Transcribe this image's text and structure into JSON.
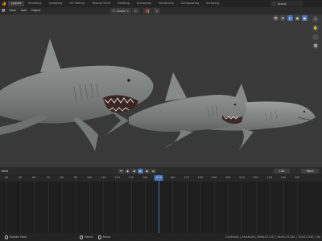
{
  "topbar": {
    "tabs": [
      "Layout",
      "Modeling",
      "Sculpting",
      "UV Editing",
      "Texture Paint",
      "Shading",
      "Animation",
      "Rendering",
      "Compositing",
      "Scripting"
    ],
    "active_tab": "Layout",
    "scene_label": "Scene"
  },
  "viewport_header": {
    "menus": [
      "View",
      "Add",
      "Object"
    ],
    "transform_orientation": "Global"
  },
  "timeline": {
    "label": "iales",
    "ticks": [
      "40",
      "50",
      "60",
      "70",
      "80",
      "90",
      "100",
      "110",
      "120",
      "130",
      "140",
      "150",
      "160",
      "170",
      "180",
      "190",
      "200",
      "210",
      "220",
      "230",
      "240",
      "250"
    ],
    "current_frame": "150",
    "current_frame_field": "150",
    "start_label": "Start"
  },
  "statusbar": {
    "items": [
      "Rotate View",
      "Select",
      "Move"
    ],
    "stats": "Collection | Armature | Verts:41,147 | Faces:76,361 | Tris:81,548 | Obj"
  },
  "colors": {
    "accent": "#4772b3",
    "viewport_bg": "#393939",
    "shark": "#7f8482"
  }
}
